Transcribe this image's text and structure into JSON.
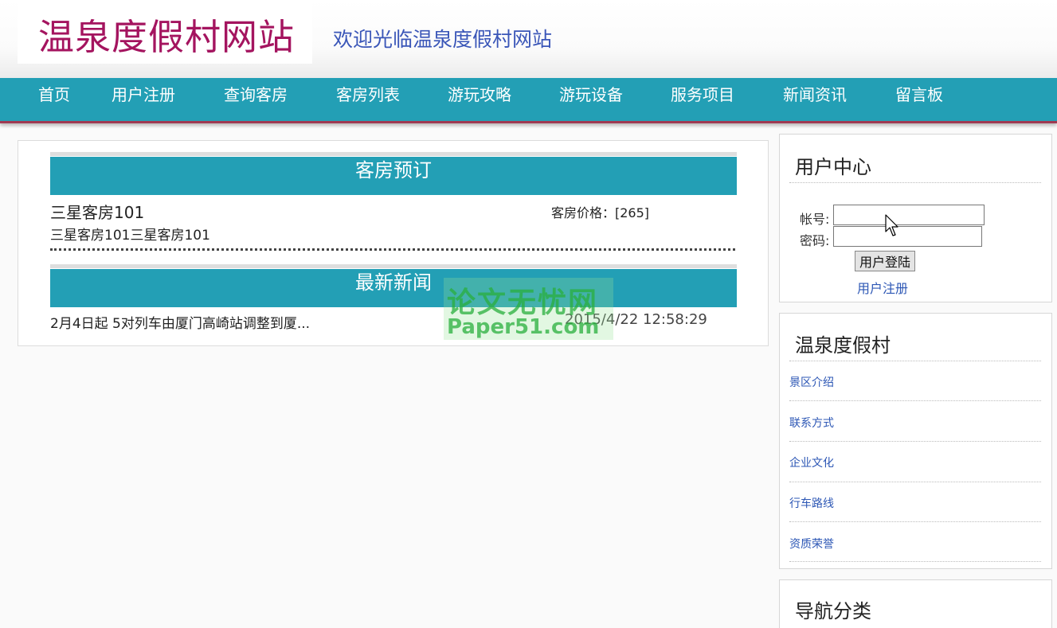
{
  "header": {
    "site_title": "温泉度假村网站",
    "welcome": "欢迎光临温泉度假村网站"
  },
  "nav": {
    "items": [
      "首页",
      "用户注册",
      "查询客房",
      "客房列表",
      "游玩攻略",
      "游玩设备",
      "服务项目",
      "新闻资讯",
      "留言板"
    ]
  },
  "booking": {
    "title": "客房预订",
    "room_name": "三星客房101",
    "price": "客房价格：[265]",
    "description": "三星客房101三星客房101"
  },
  "news": {
    "title": "最新新闻",
    "items": [
      {
        "title": "2月4日起 5对列车由厦门高崎站调整到厦...",
        "date": "2015/4/22 12:58:29"
      }
    ]
  },
  "user_center": {
    "title": "用户中心",
    "account_label": "帐号:",
    "password_label": "密码:",
    "account_value": "",
    "password_value": "",
    "login_button": "用户登陆",
    "register_link": "用户注册"
  },
  "resort": {
    "title": "温泉度假村",
    "links": [
      "景区介绍",
      "联系方式",
      "企业文化",
      "行车路线",
      "资质荣誉"
    ]
  },
  "nav_category": {
    "title": "导航分类"
  },
  "watermark": {
    "cn": "论文无忧网",
    "en": "Paper51.com"
  },
  "colors": {
    "nav_bg": "#239fb5",
    "title_color": "#a4145f",
    "link_color": "#2d57b5"
  }
}
